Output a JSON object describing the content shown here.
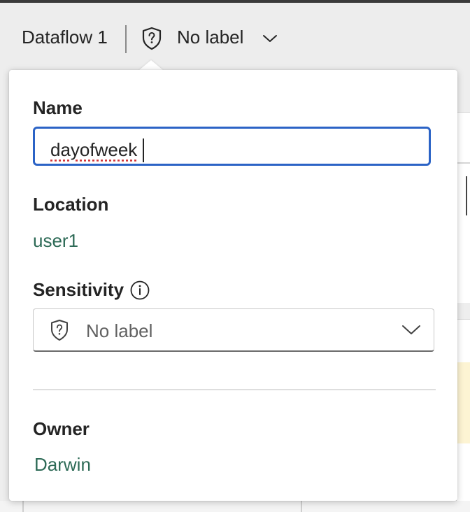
{
  "header": {
    "title": "Dataflow 1",
    "sensitivity_label": "No label",
    "icons": {
      "shield": "shield-question-icon",
      "chevron": "chevron-down-icon"
    }
  },
  "flyout": {
    "name": {
      "label": "Name",
      "value": "dayofweek"
    },
    "location": {
      "label": "Location",
      "value": "user1"
    },
    "sensitivity": {
      "label": "Sensitivity",
      "selected": "No label",
      "icons": {
        "info": "info-icon",
        "shield": "shield-question-icon",
        "chevron": "chevron-down-icon"
      }
    },
    "owner": {
      "label": "Owner",
      "value": "Darwin"
    }
  },
  "colors": {
    "accent_focus": "#2b63c6",
    "link_value": "#2d6a56",
    "text": "#242424",
    "placeholder": "#616161"
  }
}
